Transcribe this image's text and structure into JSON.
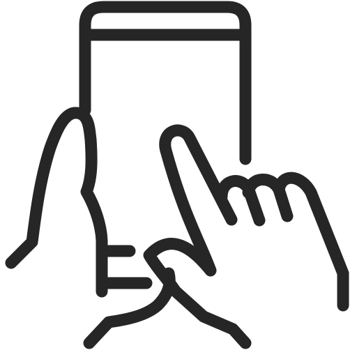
{
  "icon": {
    "name": "touchscreen-phone-icon",
    "color": "#262626",
    "background": "#ffffff"
  }
}
